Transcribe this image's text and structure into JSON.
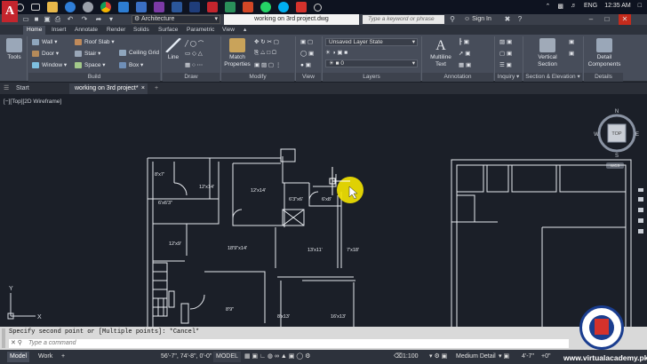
{
  "taskbar": {
    "language": "ENG",
    "time": "12:35 AM"
  },
  "titlebar": {
    "app_logo": "A",
    "workspace": "Architecture",
    "document_title": "working on 3rd project.dwg",
    "search_placeholder": "Type a keyword or phrase",
    "sign_in": "Sign In"
  },
  "ribbon_tabs": [
    "Home",
    "Insert",
    "Annotate",
    "Render",
    "Solids",
    "Surface",
    "Parametric",
    "View"
  ],
  "ribbon": {
    "tools_label": "Tools",
    "build": {
      "items": [
        "Wall",
        "Door",
        "Window",
        "Roof Slab",
        "Stair",
        "Space",
        "Ceiling Grid",
        "Box"
      ],
      "label": "Build"
    },
    "draw": {
      "line": "Line",
      "label": "Draw"
    },
    "modify": {
      "match_properties": "Match Properties",
      "label": "Modify"
    },
    "view": {
      "label": "View"
    },
    "layers": {
      "layer_state": "Unsaved Layer State",
      "layer_value": "0",
      "label": "Layers"
    },
    "annotation": {
      "multiline_text": "Multiline Text",
      "label": "Annotation"
    },
    "inquiry": {
      "label": "Inquiry"
    },
    "section": {
      "vertical_section": "Vertical Section",
      "label": "Section & Elevation"
    },
    "details": {
      "detail_components": "Detail Components",
      "label": "Details"
    }
  },
  "file_tabs": [
    "Start",
    "working on 3rd project*"
  ],
  "viewport": {
    "label": "[−][Top][2D Wireframe]",
    "viewcube_top": "TOP",
    "compass": [
      "N",
      "S",
      "E",
      "W"
    ],
    "wcs": "WCS",
    "ucs_x": "X",
    "ucs_y": "Y"
  },
  "room_labels": [
    "8'x7'",
    "12'x14'",
    "12'x14'",
    "6'3\"x6'",
    "6'x8'",
    "6'x6'3\"",
    "12'x9'",
    "18'9\"x14'",
    "13'x11'",
    "7'x18'",
    "8'9\"",
    "8'x13'",
    "16'x13'"
  ],
  "command": {
    "history": "Specify second point or [Multiple points]: *Cancel*",
    "placeholder": "Type a command"
  },
  "status": {
    "tabs": [
      "Model",
      "Work"
    ],
    "coords": "56'-7\", 74'-8\", 0'-0\"",
    "model": "MODEL",
    "scale": "1:100",
    "detail": "Medium Detail",
    "elevation": "4'-7\"",
    "offset": "+0\""
  },
  "watermark": {
    "text": "www.virtualacademy.pk"
  },
  "colors": {
    "canvas": "#1b1f28",
    "ribbon": "#474d5a",
    "autocad_red": "#c4252d",
    "cursor_highlight": "#f5e400"
  }
}
